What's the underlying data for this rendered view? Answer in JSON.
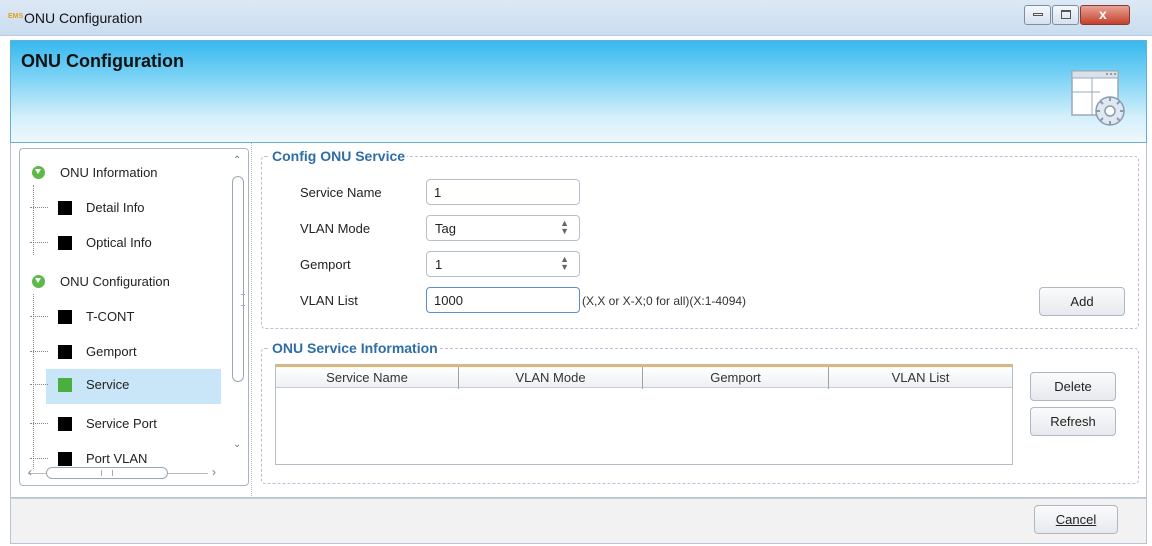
{
  "window": {
    "app_badge": "EMS",
    "title": "ONU Configuration",
    "close_glyph": "x"
  },
  "header": {
    "title": "ONU Configuration",
    "icon": "config-window-gear-icon"
  },
  "tree": {
    "items": [
      {
        "label": "ONU Information",
        "type": "parent",
        "icon": "expand-circle-icon"
      },
      {
        "label": "Detail Info",
        "type": "child"
      },
      {
        "label": "Optical Info",
        "type": "child"
      },
      {
        "label": "ONU Configuration",
        "type": "parent",
        "icon": "expand-circle-icon"
      },
      {
        "label": "T-CONT",
        "type": "child"
      },
      {
        "label": "Gemport",
        "type": "child"
      },
      {
        "label": "Service",
        "type": "child",
        "selected": true
      },
      {
        "label": "Service Port",
        "type": "child"
      },
      {
        "label": "Port VLAN",
        "type": "child"
      }
    ]
  },
  "config_service": {
    "group_title": "Config ONU Service",
    "service_name_label": "Service Name",
    "service_name_value": "1",
    "vlan_mode_label": "VLAN Mode",
    "vlan_mode_value": "Tag",
    "gemport_label": "Gemport",
    "gemport_value": "1",
    "vlan_list_label": "VLAN List",
    "vlan_list_value": "1000",
    "vlan_list_hint": "(X,X or X-X;0 for all)(X:1-4094)",
    "add_label": "Add"
  },
  "service_info": {
    "group_title": "ONU Service Information",
    "columns": [
      "Service Name",
      "VLAN Mode",
      "Gemport",
      "VLAN List"
    ],
    "rows": [],
    "delete_label": "Delete",
    "refresh_label": "Refresh"
  },
  "footer": {
    "cancel_label": "Cancel"
  },
  "colors": {
    "banner_top": "#37b8ee",
    "group_title": "#2e6ea6",
    "selection": "#c9e6f9",
    "expand_circle": "#5fb84a"
  }
}
